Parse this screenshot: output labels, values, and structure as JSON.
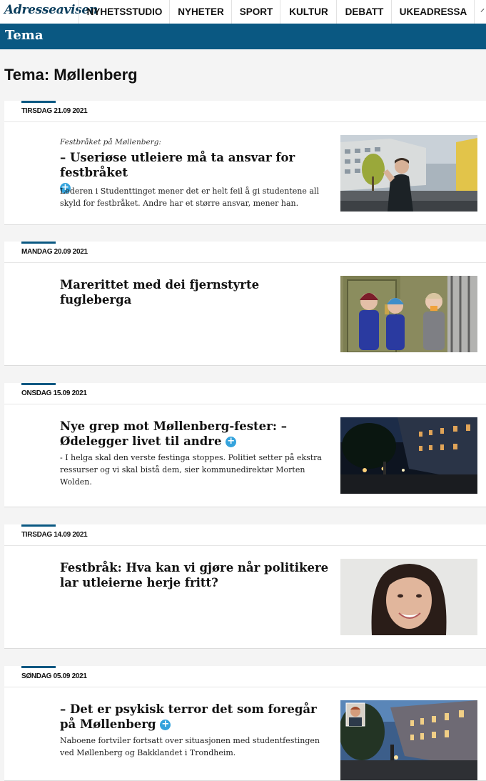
{
  "nav": {
    "logo": "Adresseavisen",
    "items": [
      {
        "label": "NYHETSSTUDIO"
      },
      {
        "label": "NYHETER"
      },
      {
        "label": "SPORT"
      },
      {
        "label": "KULTUR"
      },
      {
        "label": "DEBATT"
      },
      {
        "label": "UKEADRESSA"
      }
    ]
  },
  "section": {
    "label": "Tema"
  },
  "page": {
    "title": "Tema: Møllenberg"
  },
  "articles": [
    {
      "date": "TIRSDAG 21.09 2021",
      "kicker": "Festbråket på Møllenberg:",
      "headline": "– Useriøse utleiere må ta ansvar for festbråket",
      "plus": true,
      "lead": "Lederen i Studenttinget mener det er helt feil å gi studentene all skyld for festbråket. Andre har et større ansvar, mener han.",
      "image_icon": "street-man-photo"
    },
    {
      "date": "MANDAG 20.09 2021",
      "kicker": "",
      "headline": "Marerittet med dei fjernstyrte fugleberga",
      "plus": false,
      "lead": "",
      "image_icon": "children-door-photo"
    },
    {
      "date": "ONSDAG 15.09 2021",
      "kicker": "",
      "headline": "Nye grep mot Møllenberg-fester: – Ødelegger livet til andre",
      "plus": true,
      "lead": "- I helga skal den verste festinga stoppes. Politiet setter på ekstra ressurser og vi skal bistå dem, sier kommunedirektør Morten Wolden.",
      "image_icon": "night-street-photo"
    },
    {
      "date": "TIRSDAG 14.09 2021",
      "kicker": "",
      "headline": "Festbråk: Hva kan vi gjøre når politikere lar utleierne herje fritt?",
      "plus": false,
      "lead": "",
      "image_icon": "woman-portrait-photo"
    },
    {
      "date": "SØNDAG 05.09 2021",
      "kicker": "",
      "headline": "– Det er psykisk terror det som foregår på Møllenberg",
      "plus": true,
      "lead": "Naboene fortviler fortsatt over situasjonen med studentfestingen ved Møllenberg og Bakklandet i Trondheim.",
      "image_icon": "evening-street-photo"
    }
  ],
  "colors": {
    "brand": "#0a5882",
    "plus": "#35a3dc"
  }
}
